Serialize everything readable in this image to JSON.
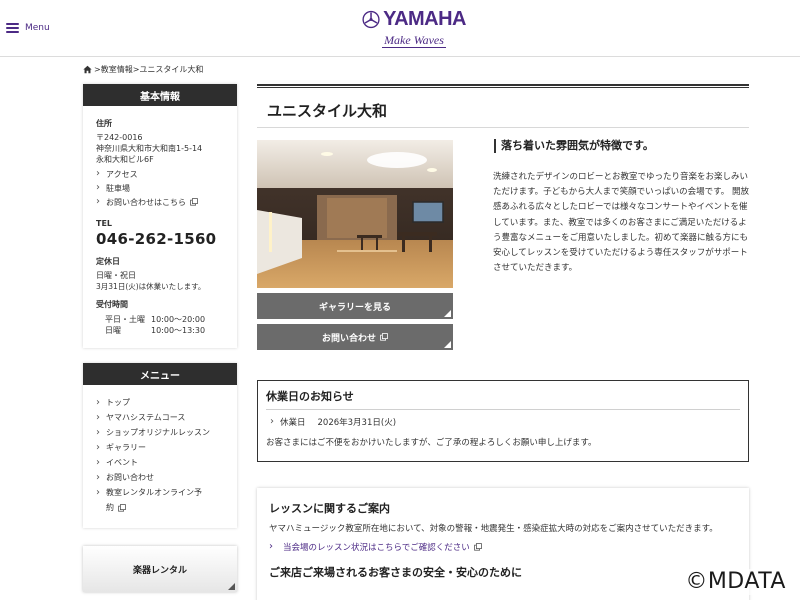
{
  "header": {
    "menu_label": "Menu",
    "logo_word": "YAMAHA",
    "logo_tagline": "Make Waves",
    "brand_color": "#4c2a85"
  },
  "breadcrumb": {
    "items": [
      "教室情報",
      "ユニスタイル大和"
    ],
    "separator": ">"
  },
  "sidebar": {
    "info": {
      "heading": "基本情報",
      "address_label": "住所",
      "address_lines": [
        "〒242-0016",
        "神奈川県大和市大和南1-5-14",
        "永和大和ビル6F"
      ],
      "links": [
        "アクセス",
        "駐車場",
        "お問い合わせはこちら"
      ],
      "tel_label": "TEL",
      "tel": "046-262-1560",
      "closed_label": "定休日",
      "closed_days": "日曜・祝日",
      "closed_note": "3月31日(火)は休業いたします。",
      "hours_label": "受付時間",
      "hours": [
        {
          "day": "平日・土曜",
          "time": "10:00～20:00"
        },
        {
          "day": "日曜",
          "time": "10:00～13:30"
        }
      ]
    },
    "menu": {
      "heading": "メニュー",
      "items": [
        "トップ",
        "ヤマハシステムコース",
        "ショップオリジナルレッスン",
        "ギャラリー",
        "イベント",
        "お問い合わせ",
        "教室レンタルオンライン予",
        "約"
      ]
    },
    "rental_label": "楽器レンタル"
  },
  "main": {
    "title": "ユニスタイル大和",
    "gallery_button": "ギャラリーを見る",
    "contact_button": "お問い合わせ",
    "subheading": "落ち着いた雰囲気が特徴です。",
    "description": "洗練されたデザインのロビーとお教室でゆったり音楽をお楽しみいただけます。子どもから大人まで笑顔でいっぱいの会場です。 開放感あふれる広々としたロビーでは様々なコンサートやイベントを催しています。また、教室では多くのお客さまにご満足いただけるよう豊富なメニューをご用意いたしました。初めて楽器に触る方にも安心してレッスンを受けていただけるよう専任スタッフがサポートさせていただきます。"
  },
  "notice": {
    "title": "休業日のお知らせ",
    "item_label": "休業日",
    "item_date": "2026年3月31日(火)",
    "message": "お客さまにはご不便をおかけいたしますが、ご了承の程よろしくお願い申し上げます。"
  },
  "lesson_info": {
    "title": "レッスンに関するご案内",
    "text": "ヤマハミュージック教室所在地において、対象の警報・地震発生・感染症拡大時の対応をご案内させていただきます。",
    "link": "当会場のレッスン状況はこちらでご確認ください",
    "title2": "ご来店ご来場されるお客さまの安全・安心のために"
  },
  "watermark": "©MDATA"
}
